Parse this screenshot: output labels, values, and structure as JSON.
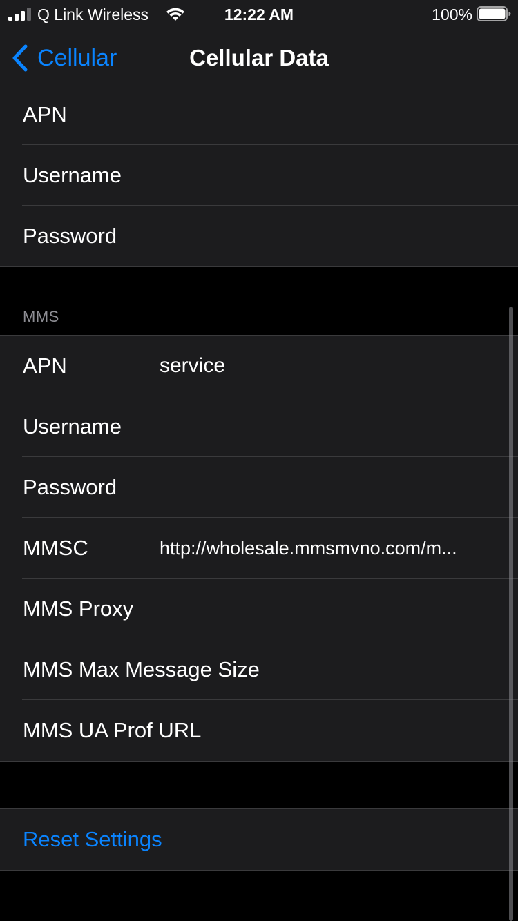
{
  "status_bar": {
    "carrier": "Q Link Wireless",
    "time": "12:22 AM",
    "battery_percent": "100%",
    "signal_bars_filled": 3,
    "signal_bars_total": 4,
    "battery_level": 1.0
  },
  "nav": {
    "back_label": "Cellular",
    "title": "Cellular Data"
  },
  "cellular_data": {
    "rows": [
      {
        "label": "APN",
        "value": ""
      },
      {
        "label": "Username",
        "value": ""
      },
      {
        "label": "Password",
        "value": ""
      }
    ]
  },
  "mms": {
    "header": "MMS",
    "rows": [
      {
        "label": "APN",
        "value": "service"
      },
      {
        "label": "Username",
        "value": ""
      },
      {
        "label": "Password",
        "value": ""
      },
      {
        "label": "MMSC",
        "value": "http://wholesale.mmsmvno.com/m..."
      },
      {
        "label": "MMS Proxy",
        "value": ""
      },
      {
        "label": "MMS Max Message Size",
        "value": ""
      },
      {
        "label": "MMS UA Prof URL",
        "value": ""
      }
    ]
  },
  "reset": {
    "label": "Reset Settings"
  },
  "colors": {
    "background": "#000000",
    "group_background": "#1c1c1e",
    "accent": "#0a84ff",
    "separator": "#3a3a3c",
    "secondary_text": "#8d8d93"
  },
  "icons": {
    "signal": "cellular-signal-icon",
    "wifi": "wifi-icon",
    "battery": "battery-icon",
    "back": "chevron-left-icon"
  }
}
